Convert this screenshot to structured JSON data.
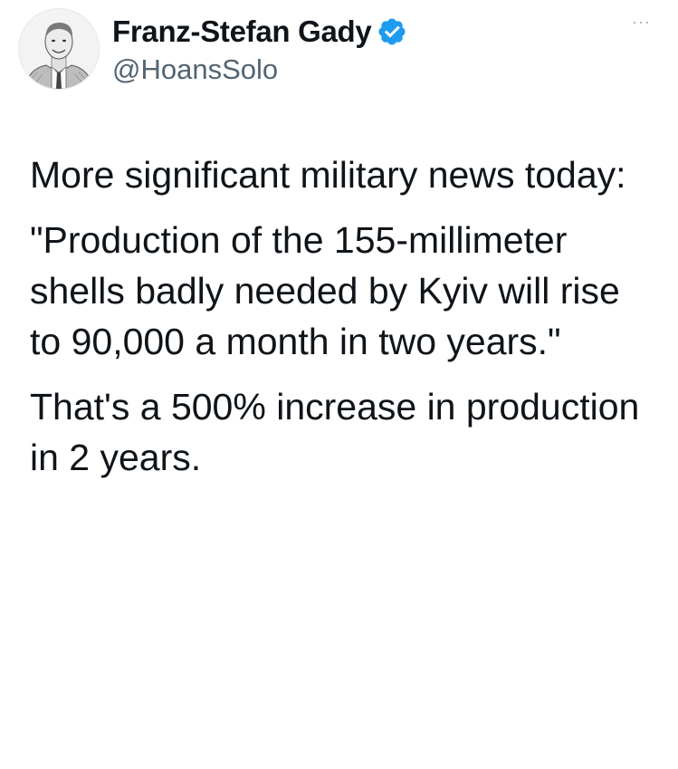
{
  "author": {
    "display_name": "Franz-Stefan Gady",
    "handle": "@HoansSolo",
    "verified": true,
    "avatar_icon": "profile-sketch-avatar",
    "verified_color": "#1d9bf0"
  },
  "menu": {
    "more_label": "···"
  },
  "tweet": {
    "paragraphs": [
      "More significant military news today:",
      "\"Production of the 155-millimeter shells badly needed by Kyiv will rise to 90,000 a month in two years.\"",
      "That's a 500% increase in production in 2 years."
    ]
  }
}
